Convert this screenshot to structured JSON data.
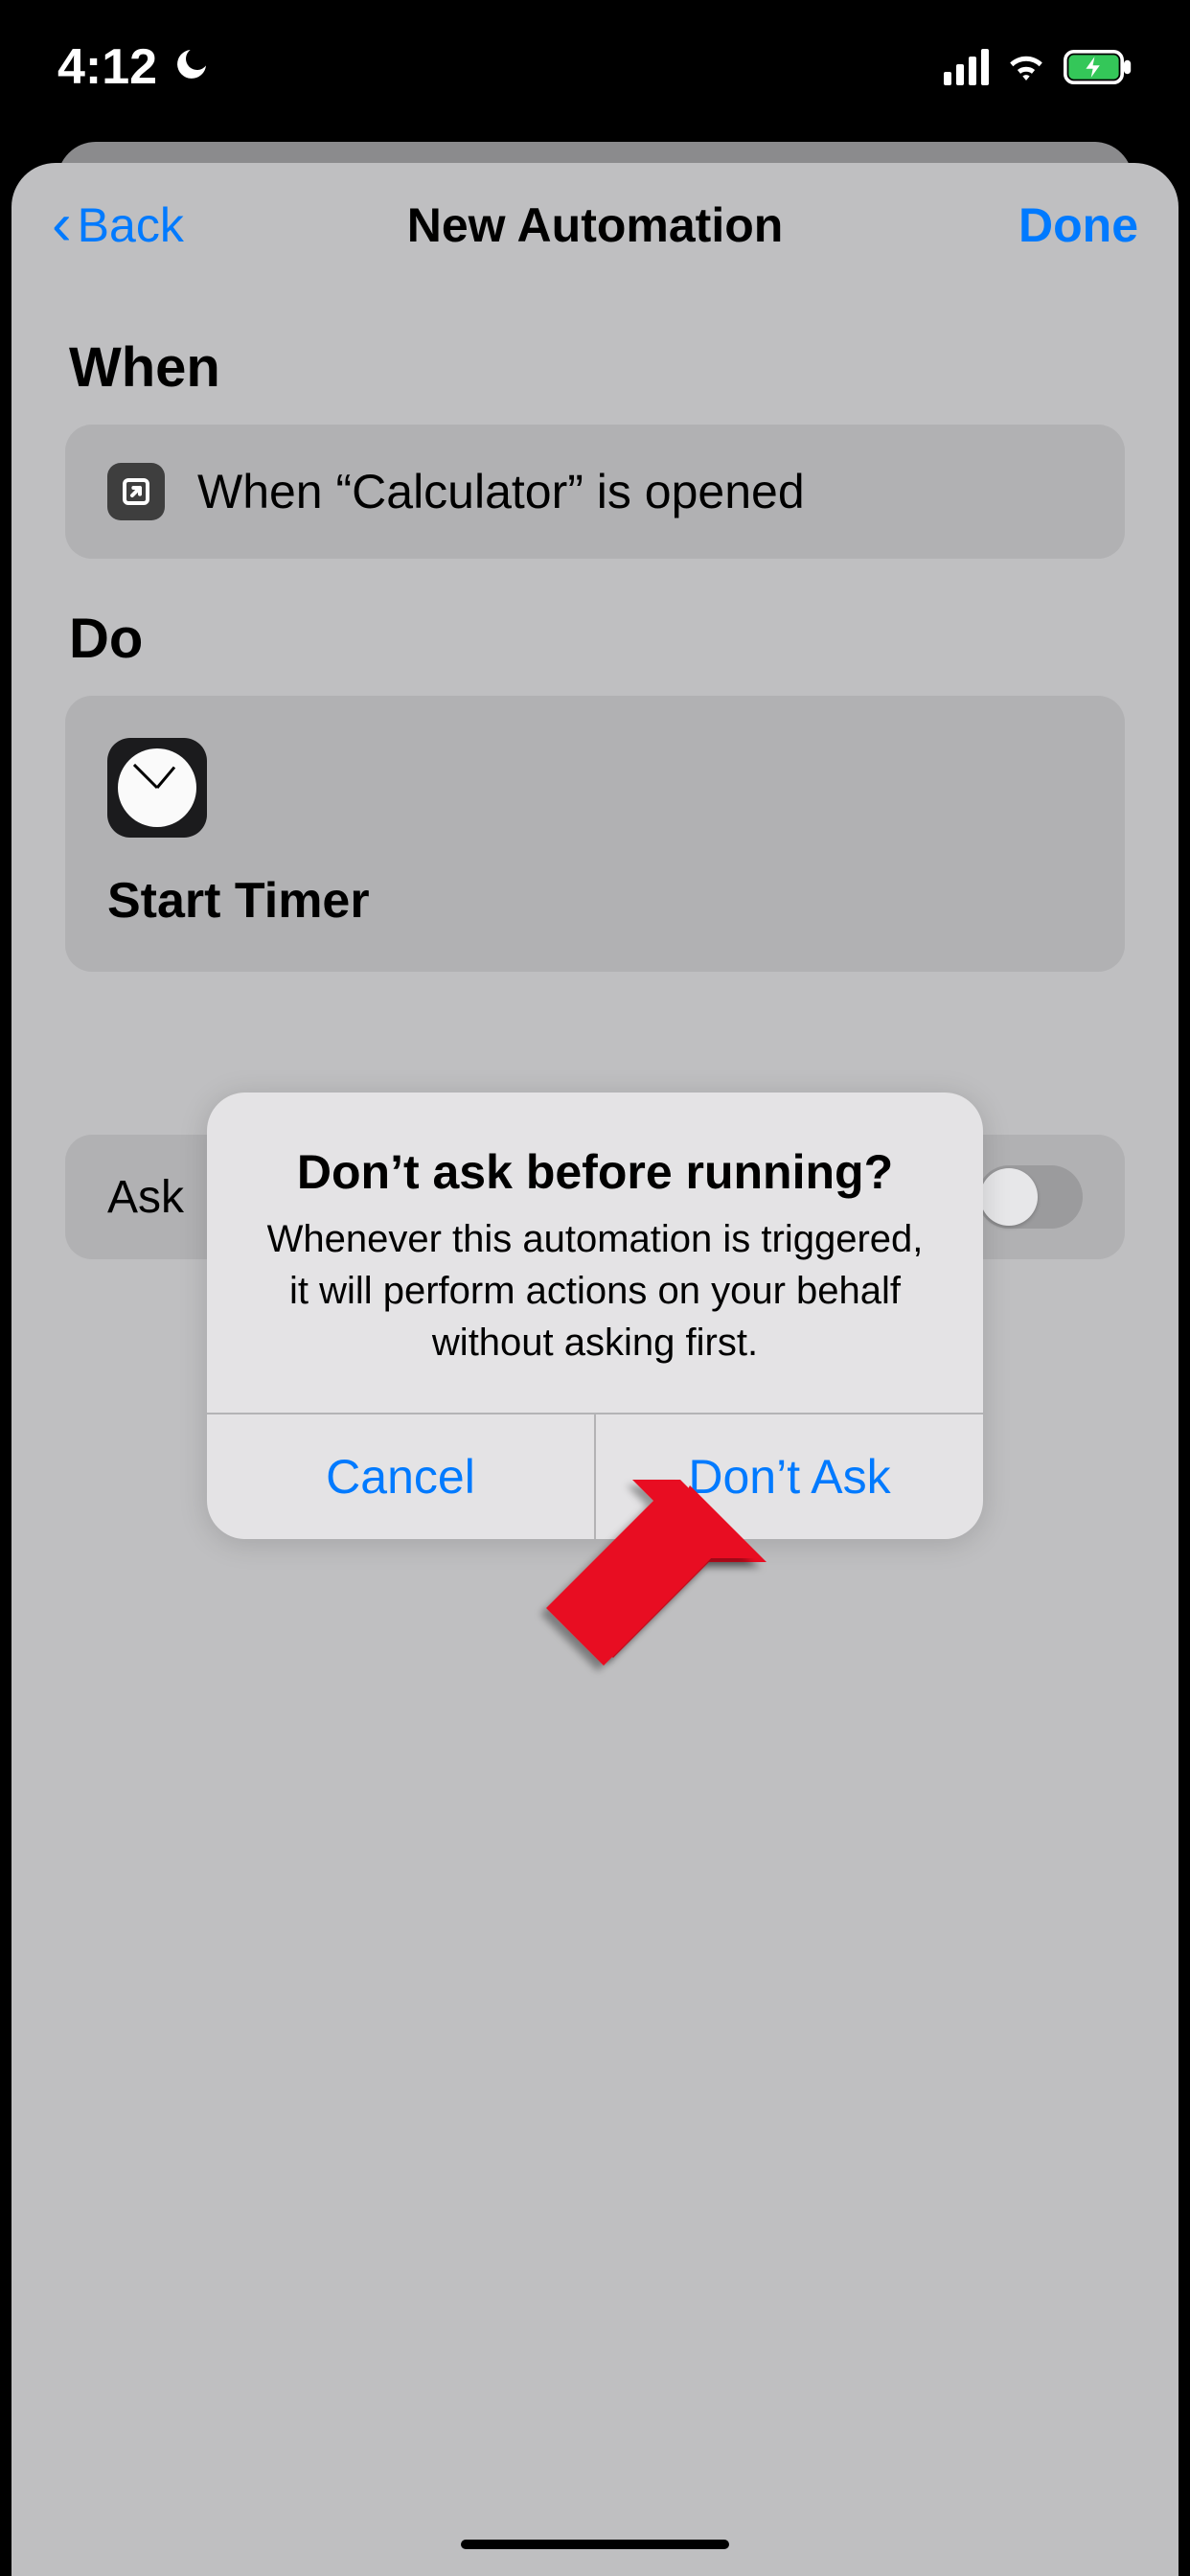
{
  "statusbar": {
    "time": "4:12"
  },
  "navbar": {
    "back": "Back",
    "title": "New Automation",
    "done": "Done"
  },
  "when": {
    "heading": "When",
    "trigger_text": "When “Calculator” is opened"
  },
  "do": {
    "heading": "Do",
    "action_name": "Start Timer"
  },
  "ask_row": {
    "label": "Ask"
  },
  "alert": {
    "title": "Don’t ask before running?",
    "message": "Whenever this automation is triggered, it will perform actions on your behalf without asking first.",
    "cancel": "Cancel",
    "confirm": "Don’t Ask"
  }
}
